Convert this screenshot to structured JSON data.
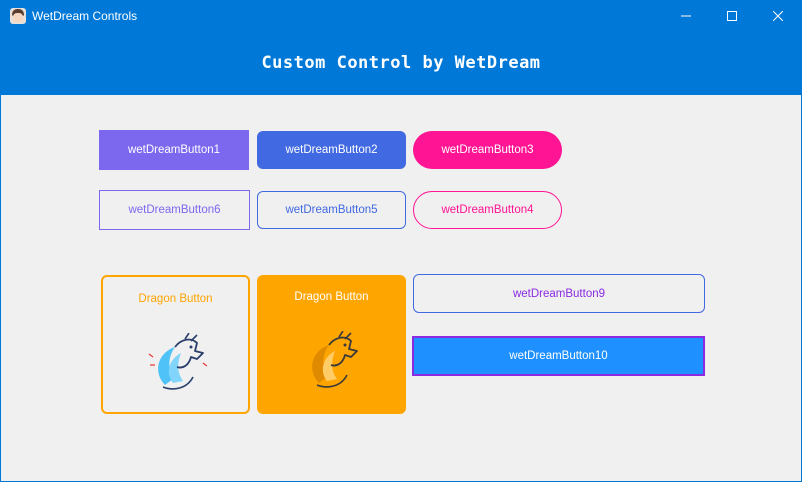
{
  "window": {
    "title": "WetDream Controls"
  },
  "header": {
    "title": "Custom Control by WetDream"
  },
  "buttons": {
    "b1": "wetDreamButton1",
    "b2": "wetDreamButton2",
    "b3": "wetDreamButton3",
    "b6": "wetDreamButton6",
    "b5": "wetDreamButton5",
    "b4": "wetDreamButton4",
    "b9": "wetDreamButton9",
    "b10": "wetDreamButton10"
  },
  "dragon_buttons": [
    {
      "label": "Dragon Button",
      "icon": "dragon-icon"
    },
    {
      "label": "Dragon Button",
      "icon": "dragon-icon"
    }
  ],
  "colors": {
    "titlebar": "#0078d7",
    "medium_slate_blue": "#7b68ee",
    "royal_blue": "#4169e1",
    "deep_pink": "#ff1493",
    "orange": "#ffa500",
    "dodger_blue": "#1e90ff",
    "blue_violet": "#8a2be2"
  }
}
